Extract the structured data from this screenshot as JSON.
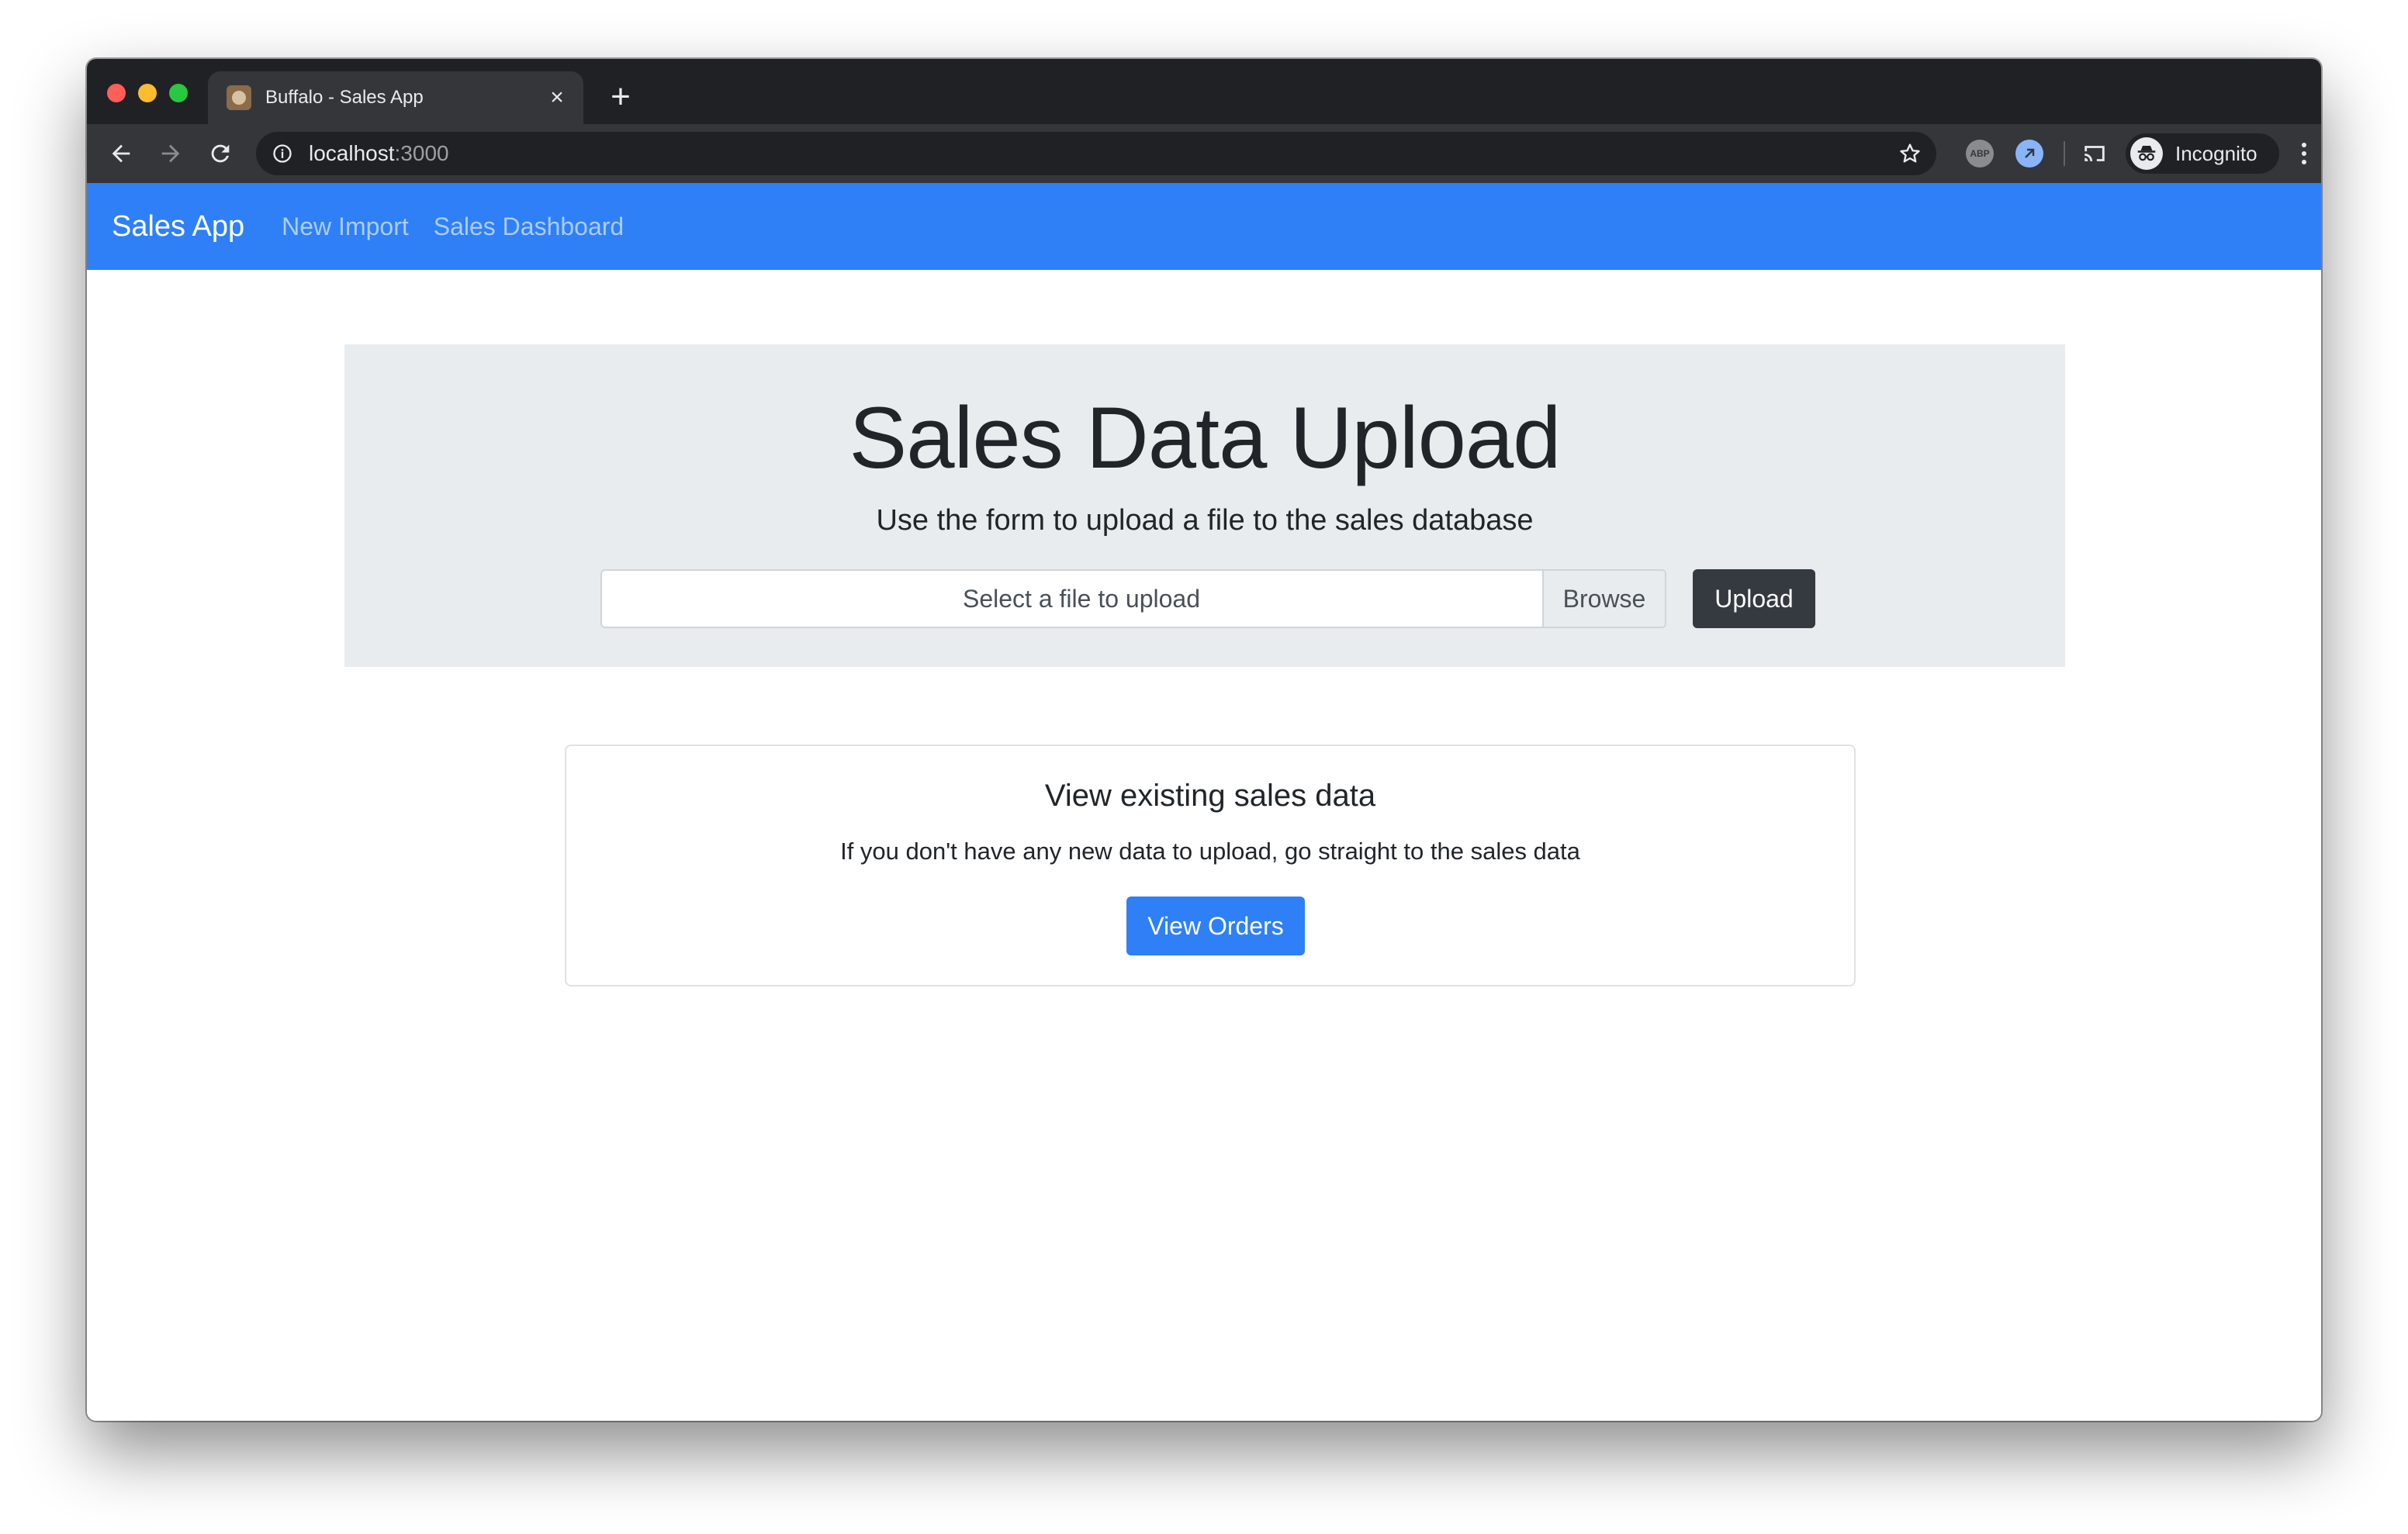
{
  "browser": {
    "tab": {
      "title": "Buffalo - Sales App",
      "favicon": "buffalo-favicon",
      "close_icon": "close-icon"
    },
    "new_tab_icon": "plus-icon",
    "toolbar": {
      "back_icon": "arrow-left-icon",
      "forward_icon": "arrow-right-icon",
      "reload_icon": "reload-icon",
      "url_host": "localhost",
      "url_port": ":3000",
      "site_info_icon": "info-icon",
      "bookmark_icon": "star-icon",
      "extensions": [
        {
          "name": "adblock-plus-icon",
          "label": "ABP"
        },
        {
          "name": "blue-extension-icon"
        }
      ],
      "cast_icon": "cast-icon",
      "profile_label": "Incognito",
      "profile_icon": "incognito-icon",
      "menu_icon": "kebab-menu-icon"
    },
    "colors": {
      "tabstrip": "#202124",
      "toolbar": "#35363a",
      "omnibox": "#202124"
    }
  },
  "navbar": {
    "brand": "Sales App",
    "links": [
      "New Import",
      "Sales Dashboard"
    ],
    "color": "#2f80f6"
  },
  "upload": {
    "title": "Sales Data Upload",
    "lead": "Use the form to upload a file to the sales database",
    "file_placeholder": "Select a file to upload",
    "browse_label": "Browse",
    "upload_label": "Upload"
  },
  "existing": {
    "title": "View existing sales data",
    "text": "If you don't have any new data to upload, go straight to the sales data",
    "button_label": "View Orders"
  }
}
